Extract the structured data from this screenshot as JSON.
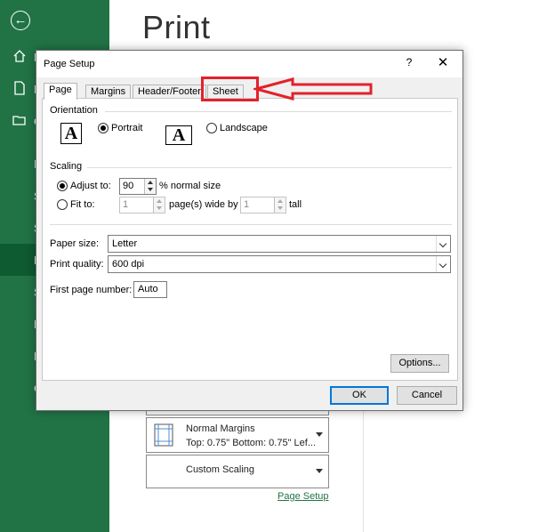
{
  "colors": {
    "sidebar_green": "#217346",
    "annotation_red": "#e3212a",
    "focus_blue": "#0078d7"
  },
  "backstage": {
    "title": "Print",
    "sidebar_items": [
      {
        "label": "H",
        "icon": "home-icon"
      },
      {
        "label": "N",
        "icon": "new-document-icon"
      },
      {
        "label": "O",
        "icon": "open-folder-icon"
      },
      {
        "label": "I"
      },
      {
        "label": "S"
      },
      {
        "label": "S"
      },
      {
        "label": "P",
        "selected": true
      },
      {
        "label": "S"
      },
      {
        "label": "E"
      },
      {
        "label": "P"
      },
      {
        "label": "C"
      }
    ],
    "margins_btn": {
      "title": "Normal Margins",
      "detail": "Top: 0.75\" Bottom: 0.75\" Lef..."
    },
    "scaling_btn": {
      "title": "Custom Scaling"
    },
    "page_setup_link": "Page Setup"
  },
  "dialog": {
    "title": "Page Setup",
    "help": "?",
    "close": "✕",
    "tabs": [
      "Page",
      "Margins",
      "Header/Footer",
      "Sheet"
    ],
    "active_tab": "Page",
    "orientation": {
      "label": "Orientation",
      "portrait": "Portrait",
      "landscape": "Landscape",
      "selected": "Portrait",
      "icon_glyph": "A"
    },
    "scaling": {
      "label": "Scaling",
      "adjust_label": "Adjust to:",
      "adjust_value": "90",
      "adjust_suffix": "% normal size",
      "fit_label": "Fit to:",
      "fit_wide_value": "1",
      "fit_wide_suffix": "page(s) wide by",
      "fit_tall_value": "1",
      "fit_tall_suffix": "tall",
      "selected": "Adjust to"
    },
    "paper_size": {
      "label": "Paper size:",
      "value": "Letter"
    },
    "print_quality": {
      "label": "Print quality:",
      "value": "600 dpi"
    },
    "first_page": {
      "label": "First page number:",
      "value": "Auto"
    },
    "options_label": "Options...",
    "ok_label": "OK",
    "cancel_label": "Cancel"
  }
}
